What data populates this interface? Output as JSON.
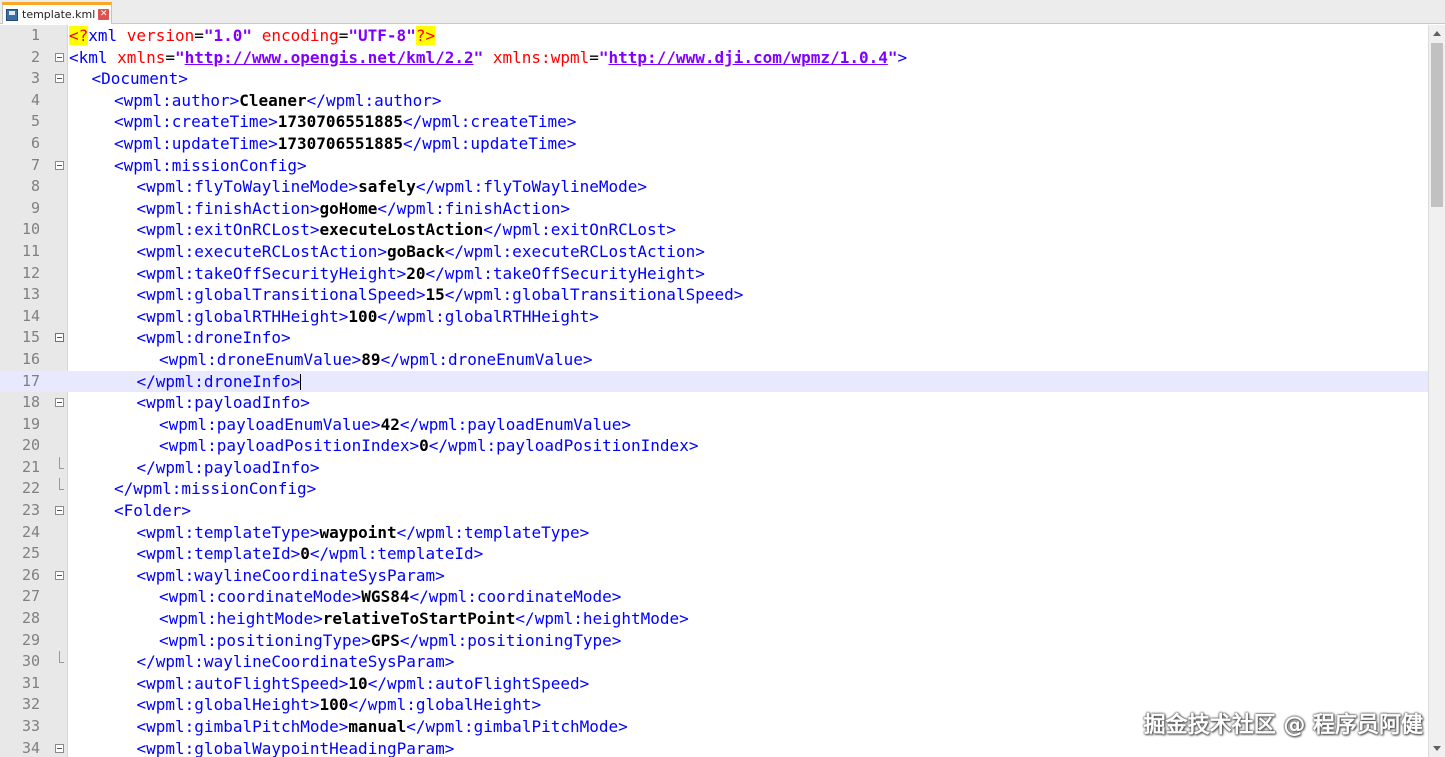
{
  "tab": {
    "filename": "template.kml",
    "file_icon": "save-disk-icon",
    "close_icon": "close-icon"
  },
  "editor": {
    "current_line": 17,
    "lines": [
      {
        "n": "1",
        "indent": 0,
        "fold": "",
        "segs": [
          [
            "pi",
            "<?"
          ],
          [
            "tag",
            "xml "
          ],
          [
            "attr",
            "version"
          ],
          [
            "eq",
            "="
          ],
          [
            "str",
            "\"1.0\""
          ],
          [
            "tag",
            " "
          ],
          [
            "attr",
            "encoding"
          ],
          [
            "eq",
            "="
          ],
          [
            "str",
            "\"UTF-8\""
          ],
          [
            "pi",
            "?>"
          ]
        ]
      },
      {
        "n": "2",
        "indent": 0,
        "fold": "open",
        "segs": [
          [
            "tag",
            "<kml "
          ],
          [
            "attr",
            "xmlns"
          ],
          [
            "eq",
            "="
          ],
          [
            "str",
            "\""
          ],
          [
            "url",
            "http://www.opengis.net/kml/2.2"
          ],
          [
            "str",
            "\""
          ],
          [
            "tag",
            " "
          ],
          [
            "attr",
            "xmlns:wpml"
          ],
          [
            "eq",
            "="
          ],
          [
            "str",
            "\""
          ],
          [
            "url",
            "http://www.dji.com/wpmz/1.0.4"
          ],
          [
            "str",
            "\""
          ],
          [
            "tag",
            ">"
          ]
        ]
      },
      {
        "n": "3",
        "indent": 1,
        "fold": "open",
        "segs": [
          [
            "tag",
            "<Document>"
          ]
        ]
      },
      {
        "n": "4",
        "indent": 2,
        "fold": "",
        "segs": [
          [
            "tag",
            "<wpml:author>"
          ],
          [
            "val",
            "Cleaner"
          ],
          [
            "tag",
            "</wpml:author>"
          ]
        ]
      },
      {
        "n": "5",
        "indent": 2,
        "fold": "",
        "segs": [
          [
            "tag",
            "<wpml:createTime>"
          ],
          [
            "val",
            "1730706551885"
          ],
          [
            "tag",
            "</wpml:createTime>"
          ]
        ]
      },
      {
        "n": "6",
        "indent": 2,
        "fold": "",
        "segs": [
          [
            "tag",
            "<wpml:updateTime>"
          ],
          [
            "val",
            "1730706551885"
          ],
          [
            "tag",
            "</wpml:updateTime>"
          ]
        ]
      },
      {
        "n": "7",
        "indent": 2,
        "fold": "open",
        "segs": [
          [
            "tag",
            "<wpml:missionConfig>"
          ]
        ]
      },
      {
        "n": "8",
        "indent": 3,
        "fold": "",
        "segs": [
          [
            "tag",
            "<wpml:flyToWaylineMode>"
          ],
          [
            "val",
            "safely"
          ],
          [
            "tag",
            "</wpml:flyToWaylineMode>"
          ]
        ]
      },
      {
        "n": "9",
        "indent": 3,
        "fold": "",
        "segs": [
          [
            "tag",
            "<wpml:finishAction>"
          ],
          [
            "val",
            "goHome"
          ],
          [
            "tag",
            "</wpml:finishAction>"
          ]
        ]
      },
      {
        "n": "10",
        "indent": 3,
        "fold": "",
        "segs": [
          [
            "tag",
            "<wpml:exitOnRCLost>"
          ],
          [
            "val",
            "executeLostAction"
          ],
          [
            "tag",
            "</wpml:exitOnRCLost>"
          ]
        ]
      },
      {
        "n": "11",
        "indent": 3,
        "fold": "",
        "segs": [
          [
            "tag",
            "<wpml:executeRCLostAction>"
          ],
          [
            "val",
            "goBack"
          ],
          [
            "tag",
            "</wpml:executeRCLostAction>"
          ]
        ]
      },
      {
        "n": "12",
        "indent": 3,
        "fold": "",
        "segs": [
          [
            "tag",
            "<wpml:takeOffSecurityHeight>"
          ],
          [
            "val",
            "20"
          ],
          [
            "tag",
            "</wpml:takeOffSecurityHeight>"
          ]
        ]
      },
      {
        "n": "13",
        "indent": 3,
        "fold": "",
        "segs": [
          [
            "tag",
            "<wpml:globalTransitionalSpeed>"
          ],
          [
            "val",
            "15"
          ],
          [
            "tag",
            "</wpml:globalTransitionalSpeed>"
          ]
        ]
      },
      {
        "n": "14",
        "indent": 3,
        "fold": "",
        "segs": [
          [
            "tag",
            "<wpml:globalRTHHeight>"
          ],
          [
            "val",
            "100"
          ],
          [
            "tag",
            "</wpml:globalRTHHeight>"
          ]
        ]
      },
      {
        "n": "15",
        "indent": 3,
        "fold": "open-red",
        "segs": [
          [
            "tag",
            "<wpml:droneInfo>"
          ]
        ]
      },
      {
        "n": "16",
        "indent": 4,
        "fold": "",
        "segs": [
          [
            "tag",
            "<wpml:droneEnumValue>"
          ],
          [
            "val",
            "89"
          ],
          [
            "tag",
            "</wpml:droneEnumValue>"
          ]
        ]
      },
      {
        "n": "17",
        "indent": 3,
        "fold": "",
        "segs": [
          [
            "tag",
            "</wpml:droneInfo>"
          ]
        ]
      },
      {
        "n": "18",
        "indent": 3,
        "fold": "open",
        "segs": [
          [
            "tag",
            "<wpml:payloadInfo>"
          ]
        ]
      },
      {
        "n": "19",
        "indent": 4,
        "fold": "",
        "segs": [
          [
            "tag",
            "<wpml:payloadEnumValue>"
          ],
          [
            "val",
            "42"
          ],
          [
            "tag",
            "</wpml:payloadEnumValue>"
          ]
        ]
      },
      {
        "n": "20",
        "indent": 4,
        "fold": "",
        "segs": [
          [
            "tag",
            "<wpml:payloadPositionIndex>"
          ],
          [
            "val",
            "0"
          ],
          [
            "tag",
            "</wpml:payloadPositionIndex>"
          ]
        ]
      },
      {
        "n": "21",
        "indent": 3,
        "fold": "end",
        "segs": [
          [
            "tag",
            "</wpml:payloadInfo>"
          ]
        ]
      },
      {
        "n": "22",
        "indent": 2,
        "fold": "end",
        "segs": [
          [
            "tag",
            "</wpml:missionConfig>"
          ]
        ]
      },
      {
        "n": "23",
        "indent": 2,
        "fold": "open",
        "segs": [
          [
            "tag",
            "<Folder>"
          ]
        ]
      },
      {
        "n": "24",
        "indent": 3,
        "fold": "",
        "segs": [
          [
            "tag",
            "<wpml:templateType>"
          ],
          [
            "val",
            "waypoint"
          ],
          [
            "tag",
            "</wpml:templateType>"
          ]
        ]
      },
      {
        "n": "25",
        "indent": 3,
        "fold": "",
        "segs": [
          [
            "tag",
            "<wpml:templateId>"
          ],
          [
            "val",
            "0"
          ],
          [
            "tag",
            "</wpml:templateId>"
          ]
        ]
      },
      {
        "n": "26",
        "indent": 3,
        "fold": "open",
        "segs": [
          [
            "tag",
            "<wpml:waylineCoordinateSysParam>"
          ]
        ]
      },
      {
        "n": "27",
        "indent": 4,
        "fold": "",
        "segs": [
          [
            "tag",
            "<wpml:coordinateMode>"
          ],
          [
            "val",
            "WGS84"
          ],
          [
            "tag",
            "</wpml:coordinateMode>"
          ]
        ]
      },
      {
        "n": "28",
        "indent": 4,
        "fold": "",
        "segs": [
          [
            "tag",
            "<wpml:heightMode>"
          ],
          [
            "val",
            "relativeToStartPoint"
          ],
          [
            "tag",
            "</wpml:heightMode>"
          ]
        ]
      },
      {
        "n": "29",
        "indent": 4,
        "fold": "",
        "segs": [
          [
            "tag",
            "<wpml:positioningType>"
          ],
          [
            "val",
            "GPS"
          ],
          [
            "tag",
            "</wpml:positioningType>"
          ]
        ]
      },
      {
        "n": "30",
        "indent": 3,
        "fold": "end",
        "segs": [
          [
            "tag",
            "</wpml:waylineCoordinateSysParam>"
          ]
        ]
      },
      {
        "n": "31",
        "indent": 3,
        "fold": "",
        "segs": [
          [
            "tag",
            "<wpml:autoFlightSpeed>"
          ],
          [
            "val",
            "10"
          ],
          [
            "tag",
            "</wpml:autoFlightSpeed>"
          ]
        ]
      },
      {
        "n": "32",
        "indent": 3,
        "fold": "",
        "segs": [
          [
            "tag",
            "<wpml:globalHeight>"
          ],
          [
            "val",
            "100"
          ],
          [
            "tag",
            "</wpml:globalHeight>"
          ]
        ]
      },
      {
        "n": "33",
        "indent": 3,
        "fold": "",
        "segs": [
          [
            "tag",
            "<wpml:gimbalPitchMode>"
          ],
          [
            "val",
            "manual"
          ],
          [
            "tag",
            "</wpml:gimbalPitchMode>"
          ]
        ]
      },
      {
        "n": "34",
        "indent": 3,
        "fold": "open",
        "segs": [
          [
            "tag",
            "<wpml:globalWaypointHeadingParam>"
          ]
        ]
      }
    ]
  },
  "watermark": "掘金技术社区 @ 程序员阿健"
}
